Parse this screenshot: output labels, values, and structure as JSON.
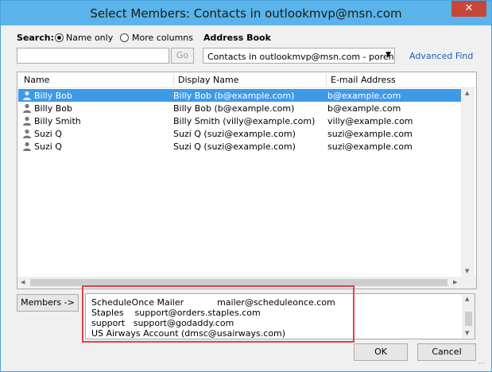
{
  "window": {
    "title": "Select Members: Contacts in outlookmvp@msn.com",
    "close_glyph": "✕"
  },
  "search": {
    "label": "Search:",
    "option_name_only": "Name only",
    "option_more_columns": "More columns",
    "selected": "Name only",
    "input_value": "",
    "go_label": "Go"
  },
  "address_book": {
    "label": "Address Book",
    "selected": "Contacts in outlookmvp@msn.com - poren",
    "advanced_find": "Advanced Find"
  },
  "table": {
    "columns": [
      "Name",
      "Display Name",
      "E-mail Address"
    ],
    "rows": [
      {
        "name": "Billy Bob",
        "display": "Billy Bob (b@example.com)",
        "email": "b@example.com",
        "selected": true
      },
      {
        "name": "Billy Bob",
        "display": "Billy Bob (b@example.com)",
        "email": "b@example.com",
        "selected": false
      },
      {
        "name": "Billy Smith",
        "display": "Billy Smith (villy@example.com)",
        "email": "villy@example.com",
        "selected": false
      },
      {
        "name": "Suzi Q",
        "display": "Suzi Q (suzi@example.com)",
        "email": "suzi@example.com",
        "selected": false
      },
      {
        "name": "Suzi Q",
        "display": "Suzi Q (suzi@example.com)",
        "email": "suzi@example.com",
        "selected": false
      }
    ],
    "row_icon": "person-icon"
  },
  "members": {
    "button_label": "Members ->",
    "lines": [
      "ScheduleOnce Mailer            mailer@scheduleonce.com",
      "Staples    support@orders.staples.com",
      "support   support@godaddy.com",
      "US Airways Account (dmsc@usairways.com)"
    ]
  },
  "footer": {
    "ok_label": "OK",
    "cancel_label": "Cancel"
  },
  "colors": {
    "selection": "#3f9ae6",
    "titlebar": "#5ab4ea",
    "close": "#c7463a",
    "highlight_box": "#e2404a",
    "link": "#1b5fb0"
  }
}
